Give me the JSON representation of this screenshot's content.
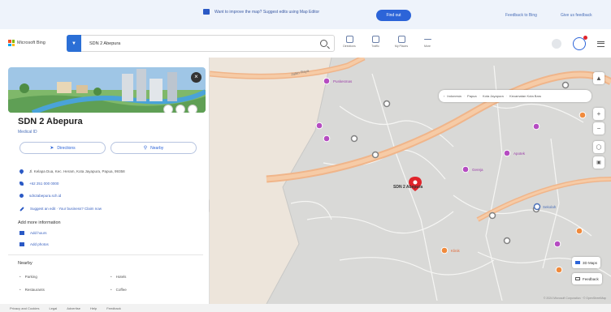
{
  "banner": {
    "message": "Want to improve the map? Suggest edits using Map Editor",
    "button_label": "Find out",
    "links": [
      "Feedback to Bing",
      "Give us feedback"
    ]
  },
  "header": {
    "brand": "Microsoft Bing",
    "search_value": "SDN 2 Abepura",
    "tools": [
      {
        "label": "Directions",
        "icon": "directions-icon"
      },
      {
        "label": "Traffic",
        "icon": "traffic-icon"
      },
      {
        "label": "My Places",
        "icon": "my-places-icon"
      },
      {
        "label": "More",
        "icon": "more-icon"
      }
    ]
  },
  "place": {
    "name": "SDN 2 Abepura",
    "category": "Medical ID",
    "actions": {
      "directions": "Directions",
      "nearby": "Nearby"
    },
    "address": "Jl. Kelapa Dua, Kec. Heram, Kota Jayapura, Papua, 99358",
    "phone": "+62 251 000 0000",
    "website": "sdn2abepura.sch.id",
    "suggest_edit": "Suggest an edit · Your business? Claim now",
    "add_more_title": "Add more information",
    "add_more_items": [
      "Add hours",
      "Add photos"
    ],
    "nearby_title": "Nearby",
    "nearby_items": [
      "Parking",
      "Hotels",
      "Restaurants",
      "Coffee"
    ]
  },
  "map": {
    "breadcrumb": [
      "Indonesia",
      "Papua",
      "Kota Jayapura",
      "Kecamatan Kota Baru"
    ],
    "road_label": "Jalan Raya",
    "selected_label": "SDN 2 Abepura",
    "chips": [
      "3D Maps",
      "Feedback"
    ],
    "poi_labels": [
      {
        "text": "Puskesmas",
        "color": "#9b3da8"
      },
      {
        "text": "Gereja",
        "color": "#9b3da8"
      },
      {
        "text": "Apotek",
        "color": "#9b3da8"
      },
      {
        "text": "Klinik",
        "color": "#e26a3a"
      },
      {
        "text": "Sekolah",
        "color": "#4a6fb8"
      }
    ],
    "attribution": "© 2024 Microsoft Corporation · © OpenStreetMap"
  },
  "footer": {
    "links": [
      "Privacy and Cookies",
      "Legal",
      "Advertise",
      "Help",
      "Feedback"
    ]
  },
  "colors": {
    "accent": "#2c64d8",
    "road": "#f0b58a",
    "map_land": "#ede5db",
    "urban": "#d9d9d7",
    "pin": "#e0242b",
    "poi_purple": "#b54cc1",
    "poi_orange": "#f08a3c",
    "poi_gray": "#808080"
  }
}
